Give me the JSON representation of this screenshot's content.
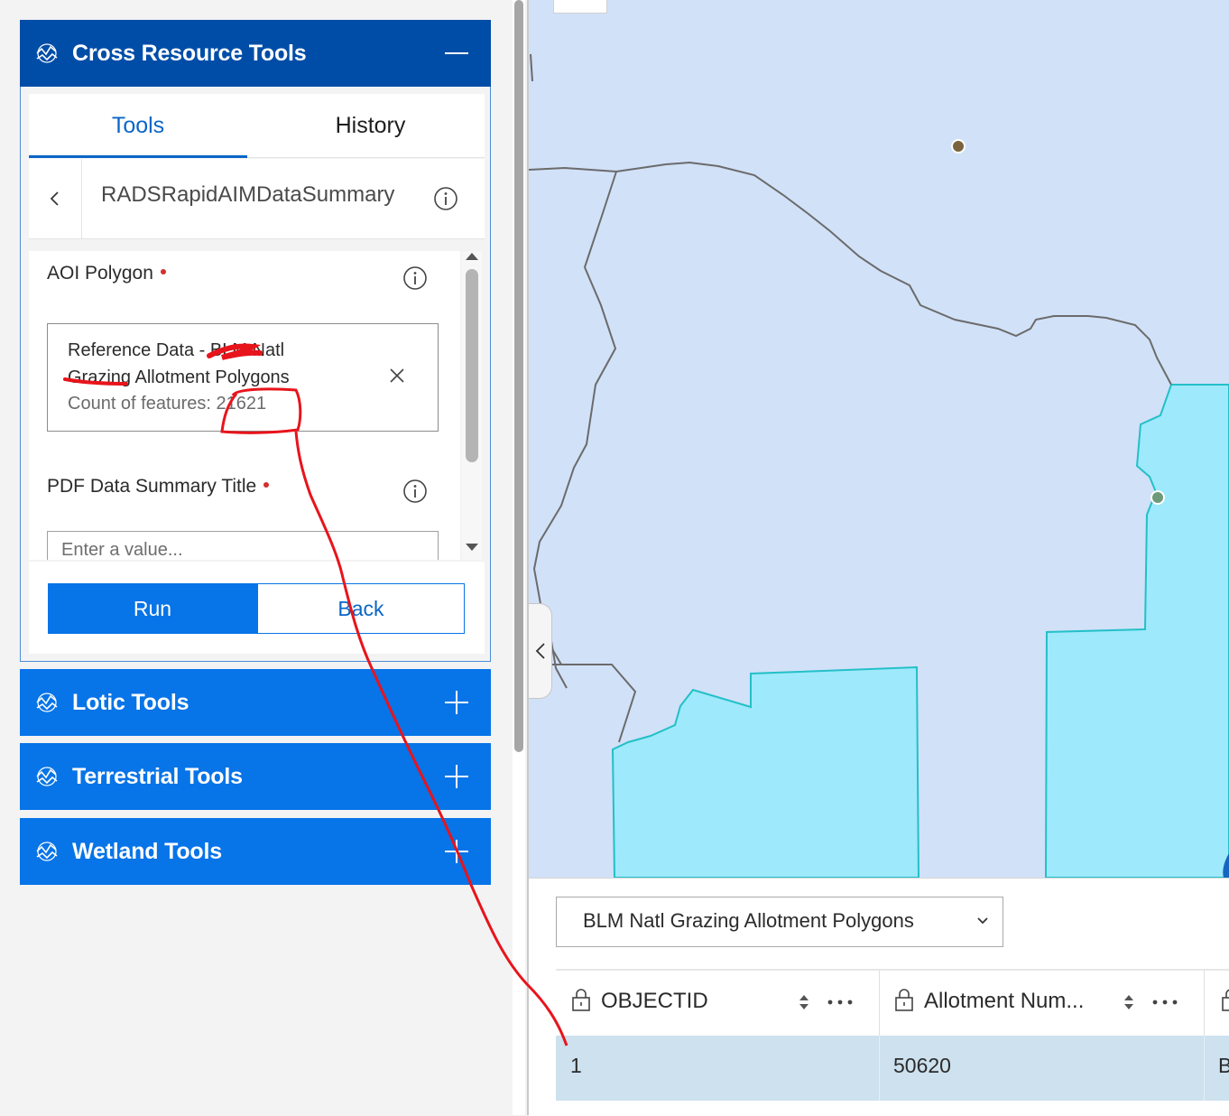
{
  "panel": {
    "tool_groups": [
      {
        "title": "Cross Resource Tools",
        "expanded": true
      },
      {
        "title": "Lotic Tools",
        "expanded": false
      },
      {
        "title": "Terrestrial Tools",
        "expanded": false
      },
      {
        "title": "Wetland Tools",
        "expanded": false
      }
    ],
    "tabs": {
      "tools": "Tools",
      "history": "History"
    },
    "tool_name": "RADSRapidAIMDataSummary",
    "fields": {
      "aoi": {
        "label": "AOI Polygon",
        "value_line1": "Reference Data - BLM Natl",
        "value_line2": "Grazing Allotment Polygons",
        "count": "Count of features: 21621"
      },
      "pdf_title": {
        "label": "PDF Data Summary Title",
        "placeholder": "Enter a value..."
      }
    },
    "buttons": {
      "run": "Run",
      "back": "Back"
    },
    "colors": {
      "header_active": "#004da8",
      "header": "#0774e8",
      "accent": "#0a66c8",
      "required": "#d32f2f"
    }
  },
  "map": {
    "colors": {
      "background": "#d1e1f8",
      "polygon_fill": "#9ee9fb",
      "polygon_outline": "#23c0c8",
      "boundary": "#6b6b6b"
    }
  },
  "table": {
    "layer": "BLM Natl Grazing Allotment Polygons",
    "columns": [
      "OBJECTID",
      "Allotment Num..."
    ],
    "rows": [
      {
        "objectid": "1",
        "allotment_num": "50620",
        "next": "B"
      }
    ]
  },
  "annotation": {
    "color": "#e8141b"
  }
}
